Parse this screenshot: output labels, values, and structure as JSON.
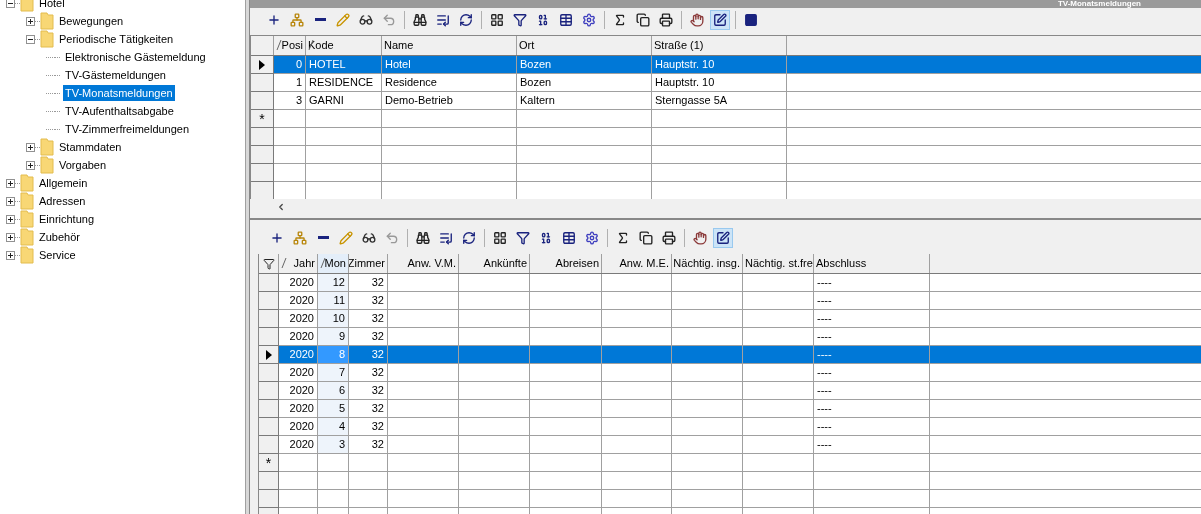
{
  "window": {
    "title": "TV-Monatsmeldungen"
  },
  "tree": [
    {
      "label": "Hotel",
      "kind": "folder",
      "expanded": true,
      "selected": false,
      "children": [
        {
          "label": "Bewegungen",
          "kind": "folder",
          "expanded": false,
          "selected": false
        },
        {
          "label": "Periodische Tätigkeiten",
          "kind": "folder",
          "expanded": true,
          "selected": false,
          "children": [
            {
              "label": "Elektronische Gästemeldung",
              "kind": "leaf",
              "selected": false
            },
            {
              "label": "TV-Gästemeldungen",
              "kind": "leaf",
              "selected": false
            },
            {
              "label": "TV-Monatsmeldungen",
              "kind": "leaf",
              "selected": true
            },
            {
              "label": "TV-Aufenthaltsabgabe",
              "kind": "leaf",
              "selected": false
            },
            {
              "label": "TV-Zimmerfreimeldungen",
              "kind": "leaf",
              "selected": false
            }
          ]
        },
        {
          "label": "Stammdaten",
          "kind": "folder",
          "expanded": false,
          "selected": false
        },
        {
          "label": "Vorgaben",
          "kind": "folder",
          "expanded": false,
          "selected": false
        }
      ]
    },
    {
      "label": "Allgemein",
      "kind": "folder",
      "expanded": false,
      "selected": false
    },
    {
      "label": "Adressen",
      "kind": "folder",
      "expanded": false,
      "selected": false
    },
    {
      "label": "Einrichtung",
      "kind": "folder",
      "expanded": false,
      "selected": false
    },
    {
      "label": "Zubehör",
      "kind": "folder",
      "expanded": false,
      "selected": false
    },
    {
      "label": "Service",
      "kind": "folder",
      "expanded": false,
      "selected": false
    }
  ],
  "toolbar_top": [
    {
      "kind": "add",
      "pressed": false
    },
    {
      "kind": "add-sub",
      "pressed": false
    },
    {
      "kind": "remove",
      "pressed": false
    },
    {
      "kind": "edit",
      "pressed": false
    },
    {
      "kind": "view",
      "pressed": false
    },
    {
      "kind": "undo",
      "pressed": false
    },
    {
      "kind": "sep"
    },
    {
      "kind": "find",
      "pressed": false
    },
    {
      "kind": "goto",
      "pressed": false
    },
    {
      "kind": "refresh",
      "pressed": false
    },
    {
      "kind": "sep"
    },
    {
      "kind": "layout",
      "pressed": false
    },
    {
      "kind": "filter",
      "pressed": false
    },
    {
      "kind": "format",
      "pressed": false
    },
    {
      "kind": "table",
      "pressed": false
    },
    {
      "kind": "settings",
      "pressed": false
    },
    {
      "kind": "sep"
    },
    {
      "kind": "sum",
      "pressed": false
    },
    {
      "kind": "copy",
      "pressed": false
    },
    {
      "kind": "print",
      "pressed": false
    },
    {
      "kind": "sep"
    },
    {
      "kind": "point",
      "pressed": false
    },
    {
      "kind": "edit-grid",
      "pressed": true
    },
    {
      "kind": "sep"
    },
    {
      "kind": "stop",
      "pressed": false
    }
  ],
  "grid_top": {
    "new_row_marker": "*",
    "columns": [
      {
        "label": "Posi",
        "sort_marker": true
      },
      {
        "label": "Kode",
        "sort_marker": true
      },
      {
        "label": "Name",
        "sort_marker": false
      },
      {
        "label": "Ort",
        "sort_marker": false
      },
      {
        "label": "Straße (1)",
        "sort_marker": false
      }
    ],
    "rows": [
      {
        "selected": true,
        "cells": [
          "0",
          "HOTEL",
          "Hotel",
          "Bozen",
          "Hauptstr. 10"
        ]
      },
      {
        "selected": false,
        "cells": [
          "1",
          "RESIDENCE",
          "Residence",
          "Bozen",
          "Hauptstr. 10"
        ]
      },
      {
        "selected": false,
        "cells": [
          "3",
          "GARNI",
          "Demo-Betrieb",
          "Kaltern",
          "Sterngasse 5A"
        ]
      }
    ]
  },
  "toolbar_bottom": [
    {
      "kind": "add",
      "pressed": false
    },
    {
      "kind": "add-sub",
      "pressed": false
    },
    {
      "kind": "remove",
      "pressed": false
    },
    {
      "kind": "edit",
      "pressed": false
    },
    {
      "kind": "view",
      "pressed": false
    },
    {
      "kind": "undo",
      "pressed": false
    },
    {
      "kind": "sep"
    },
    {
      "kind": "find",
      "pressed": false
    },
    {
      "kind": "goto",
      "pressed": false
    },
    {
      "kind": "refresh",
      "pressed": false
    },
    {
      "kind": "sep"
    },
    {
      "kind": "layout",
      "pressed": false
    },
    {
      "kind": "filter",
      "pressed": false
    },
    {
      "kind": "format",
      "pressed": false
    },
    {
      "kind": "table",
      "pressed": false
    },
    {
      "kind": "settings",
      "pressed": false
    },
    {
      "kind": "sep"
    },
    {
      "kind": "sum",
      "pressed": false
    },
    {
      "kind": "copy",
      "pressed": false
    },
    {
      "kind": "print",
      "pressed": false
    },
    {
      "kind": "sep"
    },
    {
      "kind": "point",
      "pressed": false
    },
    {
      "kind": "edit-grid",
      "pressed": true
    }
  ],
  "grid_bottom": {
    "new_row_marker": "*",
    "columns": [
      {
        "label": "Jahr",
        "sort_marker": true,
        "tinted": false
      },
      {
        "label": "Mon",
        "sort_marker": true,
        "tinted": true
      },
      {
        "label": "Zimmer",
        "sort_marker": false,
        "tinted": false
      },
      {
        "label": "Anw. V.M.",
        "sort_marker": false,
        "tinted": false
      },
      {
        "label": "Ankünfte",
        "sort_marker": false,
        "tinted": false
      },
      {
        "label": "Abreisen",
        "sort_marker": false,
        "tinted": false
      },
      {
        "label": "Anw. M.E.",
        "sort_marker": false,
        "tinted": false
      },
      {
        "label": "Nächtig. insg.",
        "sort_marker": false,
        "tinted": false
      },
      {
        "label": "Nächtig. st.fre",
        "sort_marker": false,
        "tinted": false
      },
      {
        "label": "Abschluss",
        "sort_marker": false,
        "tinted": false
      }
    ],
    "rows": [
      {
        "selected": false,
        "cells": [
          "2020",
          "12",
          "32",
          "----"
        ]
      },
      {
        "selected": false,
        "cells": [
          "2020",
          "11",
          "32",
          "----"
        ]
      },
      {
        "selected": false,
        "cells": [
          "2020",
          "10",
          "32",
          "----"
        ]
      },
      {
        "selected": false,
        "cells": [
          "2020",
          "9",
          "32",
          "----"
        ]
      },
      {
        "selected": true,
        "cells": [
          "2020",
          "8",
          "32",
          "----"
        ]
      },
      {
        "selected": false,
        "cells": [
          "2020",
          "7",
          "32",
          "----"
        ]
      },
      {
        "selected": false,
        "cells": [
          "2020",
          "6",
          "32",
          "----"
        ]
      },
      {
        "selected": false,
        "cells": [
          "2020",
          "5",
          "32",
          "----"
        ]
      },
      {
        "selected": false,
        "cells": [
          "2020",
          "4",
          "32",
          "----"
        ]
      },
      {
        "selected": false,
        "cells": [
          "2020",
          "3",
          "32",
          "----"
        ]
      }
    ]
  }
}
